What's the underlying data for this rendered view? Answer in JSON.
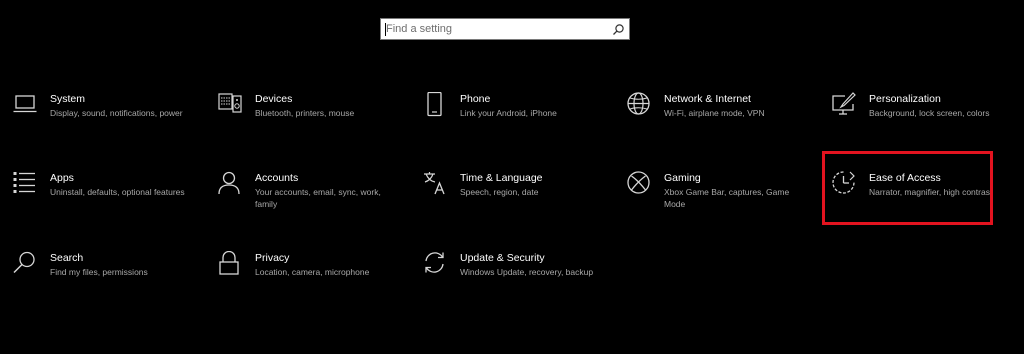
{
  "search": {
    "placeholder": "Find a setting",
    "value": ""
  },
  "tiles": [
    {
      "title": "System",
      "desc": "Display, sound, notifications, power",
      "icon": "laptop-icon"
    },
    {
      "title": "Devices",
      "desc": "Bluetooth, printers, mouse",
      "icon": "keyboard-speaker-icon"
    },
    {
      "title": "Phone",
      "desc": "Link your Android, iPhone",
      "icon": "phone-icon"
    },
    {
      "title": "Network & Internet",
      "desc": "Wi-Fi, airplane mode, VPN",
      "icon": "globe-icon"
    },
    {
      "title": "Personalization",
      "desc": "Background, lock screen, colors",
      "icon": "paint-monitor-icon"
    },
    {
      "title": "Apps",
      "desc": "Uninstall, defaults, optional features",
      "icon": "app-list-icon"
    },
    {
      "title": "Accounts",
      "desc": "Your accounts, email, sync, work, family",
      "icon": "person-icon"
    },
    {
      "title": "Time & Language",
      "desc": "Speech, region, date",
      "icon": "time-language-icon"
    },
    {
      "title": "Gaming",
      "desc": "Xbox Game Bar, captures, Game Mode",
      "icon": "xbox-icon"
    },
    {
      "title": "Ease of Access",
      "desc": "Narrator, magnifier, high contrast",
      "icon": "ease-of-access-icon"
    },
    {
      "title": "Search",
      "desc": "Find my files, permissions",
      "icon": "search-icon"
    },
    {
      "title": "Privacy",
      "desc": "Location, camera, microphone",
      "icon": "lock-icon"
    },
    {
      "title": "Update & Security",
      "desc": "Windows Update, recovery, backup",
      "icon": "sync-arrows-icon"
    }
  ],
  "colors": {
    "background": "#000000",
    "title_text": "#ffffff",
    "desc_text": "#a8a8a8",
    "highlight": "#e3131f"
  }
}
